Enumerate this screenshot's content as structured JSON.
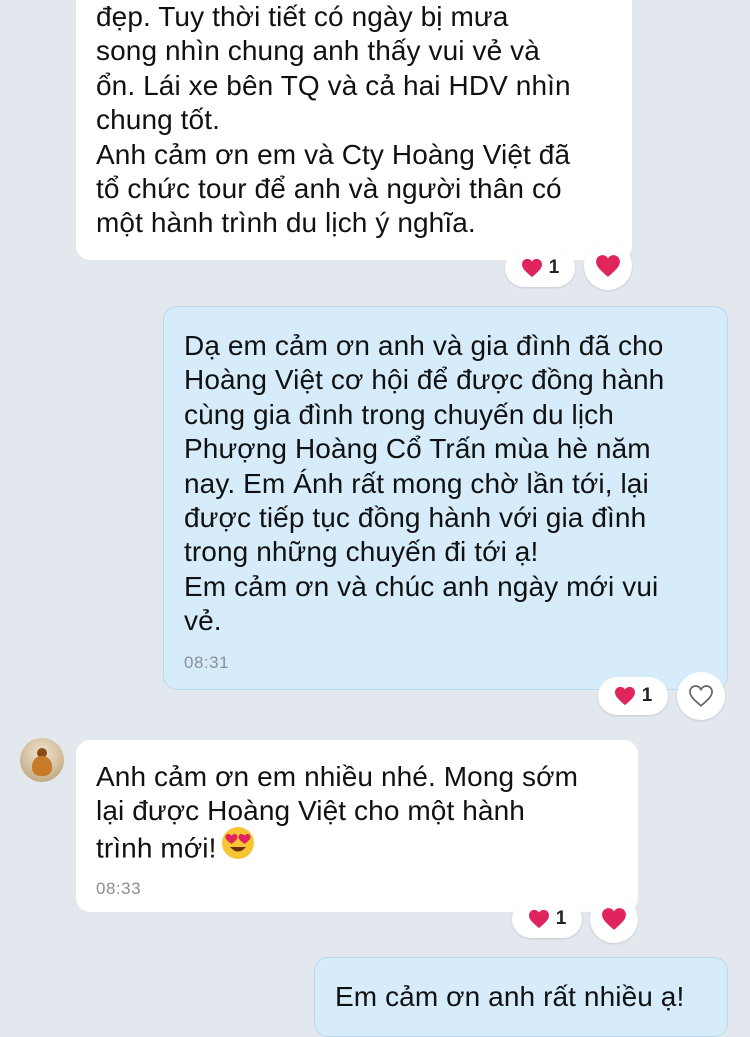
{
  "messages": [
    {
      "direction": "incoming",
      "lines": [
        "đẹp. Tuy thời tiết có ngày bị mưa",
        "song nhìn chung anh thấy vui vẻ và",
        "ổn. Lái xe bên TQ và cả hai HDV nhìn",
        "chung tốt.",
        "Anh cảm ơn em và Cty Hoàng Việt đã",
        "tổ chức tour để anh và người thân có",
        "một hành trình du lịch ý nghĩa."
      ],
      "reaction_count": "1",
      "reaction_icon": "heart-icon",
      "react_button_icon": "heart-filled-icon"
    },
    {
      "direction": "outgoing",
      "lines": [
        "Dạ em cảm ơn anh và gia đình đã cho",
        "Hoàng Việt cơ hội để được đồng hành",
        "cùng gia đình trong chuyến du lịch",
        "Phượng Hoàng Cổ Trấn mùa hè năm",
        "nay. Em Ánh rất mong chờ lần tới, lại",
        "được tiếp tục đồng hành với gia đình",
        "trong những chuyến đi tới ạ!",
        "Em cảm ơn và chúc anh ngày mới vui",
        "vẻ."
      ],
      "time": "08:31",
      "reaction_count": "1",
      "reaction_icon": "heart-icon",
      "react_button_icon": "heart-outline-icon"
    },
    {
      "direction": "incoming",
      "lines": [
        "Anh cảm ơn em nhiều nhé. Mong sớm",
        "lại được Hoàng Việt cho một hành",
        "trình mới!"
      ],
      "emoji": "heart-eyes-emoji",
      "time": "08:33",
      "reaction_count": "1",
      "reaction_icon": "heart-icon",
      "react_button_icon": "heart-filled-icon"
    },
    {
      "direction": "outgoing",
      "lines": [
        "Em cảm ơn anh rất nhiều ạ!"
      ]
    }
  ],
  "colors": {
    "background": "#e3e7ee",
    "incoming_bubble": "#ffffff",
    "outgoing_bubble": "#d6ecfb",
    "heart": "#e0245e",
    "timestamp": "#8a8f96"
  }
}
